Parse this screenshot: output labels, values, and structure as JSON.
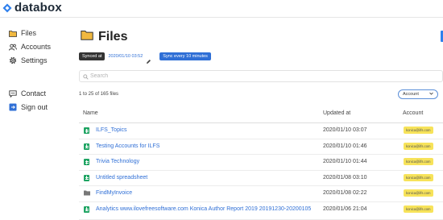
{
  "brand": {
    "name": "databox"
  },
  "sidebar": {
    "items": [
      {
        "label": "Files",
        "icon": "folder-icon"
      },
      {
        "label": "Accounts",
        "icon": "users-icon"
      },
      {
        "label": "Settings",
        "icon": "gear-icon"
      },
      {
        "label": "Contact",
        "icon": "chat-icon"
      },
      {
        "label": "Sign out",
        "icon": "sign-out-icon"
      }
    ]
  },
  "main": {
    "title": "Files",
    "sync": {
      "synced_label": "Synced at",
      "synced_time": "2020/01/10 03:52",
      "sync_every": "Sync every 10 minutes"
    },
    "search": {
      "placeholder": "Search"
    },
    "count_text": "1 to 25 of 165 files",
    "account_filter": "Account",
    "table": {
      "headers": {
        "name": "Name",
        "updated": "Updated at",
        "account": "Account"
      },
      "rows": [
        {
          "type": "sheet",
          "name": "ILFS_Topics",
          "updated": "2020/01/10 03:07",
          "account": "konica@ilfs.com"
        },
        {
          "type": "sheet",
          "name": "Testing Accounts for ILFS",
          "updated": "2020/01/10 01:46",
          "account": "konica@ilfs.com"
        },
        {
          "type": "sheet",
          "name": "Trivia Technology",
          "updated": "2020/01/10 01:44",
          "account": "konica@ilfs.com"
        },
        {
          "type": "sheet",
          "name": "Untitled spreadsheet",
          "updated": "2020/01/08 03:10",
          "account": "konica@ilfs.com"
        },
        {
          "type": "folder",
          "name": "FindMyInvoice",
          "updated": "2020/01/08 02:22",
          "account": "konica@ilfs.com"
        },
        {
          "type": "sheet",
          "name": "Analytics www.ilovefreesoftware.com Konica Author Report 2019 20191230-20200105",
          "updated": "2020/01/06 21:04",
          "account": "konica@ilfs.com"
        }
      ]
    }
  },
  "colors": {
    "accent": "#2f6fd6",
    "sheet_green": "#1fa463",
    "account_badge": "#f7e35a",
    "folder": "#f0b840"
  }
}
